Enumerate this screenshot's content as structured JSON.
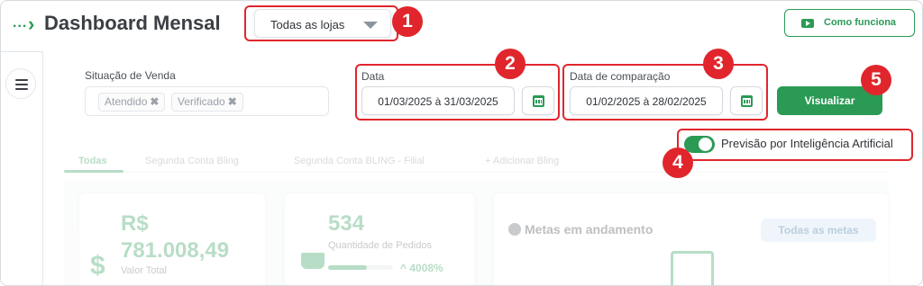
{
  "header": {
    "breadcrumb_dots": "...",
    "breadcrumb_arrow": "›",
    "title": "Dashboard Mensal",
    "store_select": "Todas as lojas",
    "how_it_works": "Como funciona"
  },
  "filters": {
    "status_label": "Situação de Venda",
    "status_chips": [
      "Atendido",
      "Verificado"
    ],
    "chip_remove": "✖",
    "date_label": "Data",
    "date_value": "01/03/2025 à 31/03/2025",
    "compare_label": "Data de comparação",
    "compare_value": "01/02/2025 à 28/02/2025",
    "visualize": "Visualizar",
    "ai_toggle_label": "Previsão por Inteligência Artificial",
    "ai_toggle_on": true
  },
  "tabs": [
    "Todas",
    "Segunda Conta Bling",
    "Segunda Conta BLING - Filial",
    "+ Adicionar Bling"
  ],
  "cards": {
    "revenue_currency": "R$",
    "revenue_value": "781.008,49",
    "revenue_label": "Valor Total",
    "revenue_icon": "$",
    "orders_value": "534",
    "orders_label": "Quantidade de Pedidos",
    "orders_change": "^ 4008%",
    "orders_progress": 0.6,
    "goals_title": "Metas em andamento",
    "goals_badge": "Todas as metas"
  },
  "annotations": [
    "1",
    "2",
    "3",
    "4",
    "5"
  ],
  "colors": {
    "brand_green": "#2a9a55",
    "annotation_red": "#e0262c"
  },
  "icons": [
    "menu-icon",
    "youtube-icon",
    "calendar-icon",
    "chevron-down-icon",
    "dollar-icon",
    "cart-icon",
    "info-icon",
    "add-document-icon"
  ]
}
